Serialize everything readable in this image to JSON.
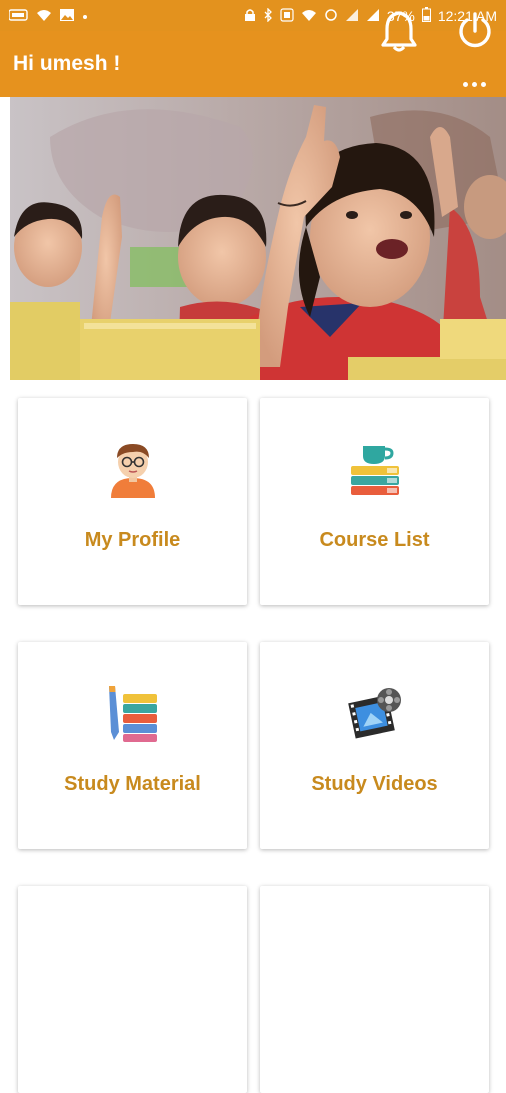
{
  "status_bar": {
    "battery": "37%",
    "time": "12:21 AM",
    "left_icons": [
      "app-icon",
      "wifi-icon",
      "image-icon",
      "dot-icon"
    ],
    "right_icons": [
      "lock-icon",
      "bluetooth-icon",
      "volte-icon",
      "wifi-icon",
      "sync-icon",
      "signal-icon",
      "signal-icon",
      "battery-icon"
    ]
  },
  "toolbar": {
    "greeting": "Hi umesh !",
    "icons": [
      "bell-icon",
      "power-icon"
    ]
  },
  "menu": {
    "items": [
      {
        "label": "My Profile",
        "icon": "profile-icon"
      },
      {
        "label": "Course List",
        "icon": "books-icon"
      },
      {
        "label": "Study Material",
        "icon": "study-material-icon"
      },
      {
        "label": "Study Videos",
        "icon": "video-reel-icon"
      }
    ]
  },
  "colors": {
    "primary": "#e6921e",
    "label": "#c88a1e"
  }
}
